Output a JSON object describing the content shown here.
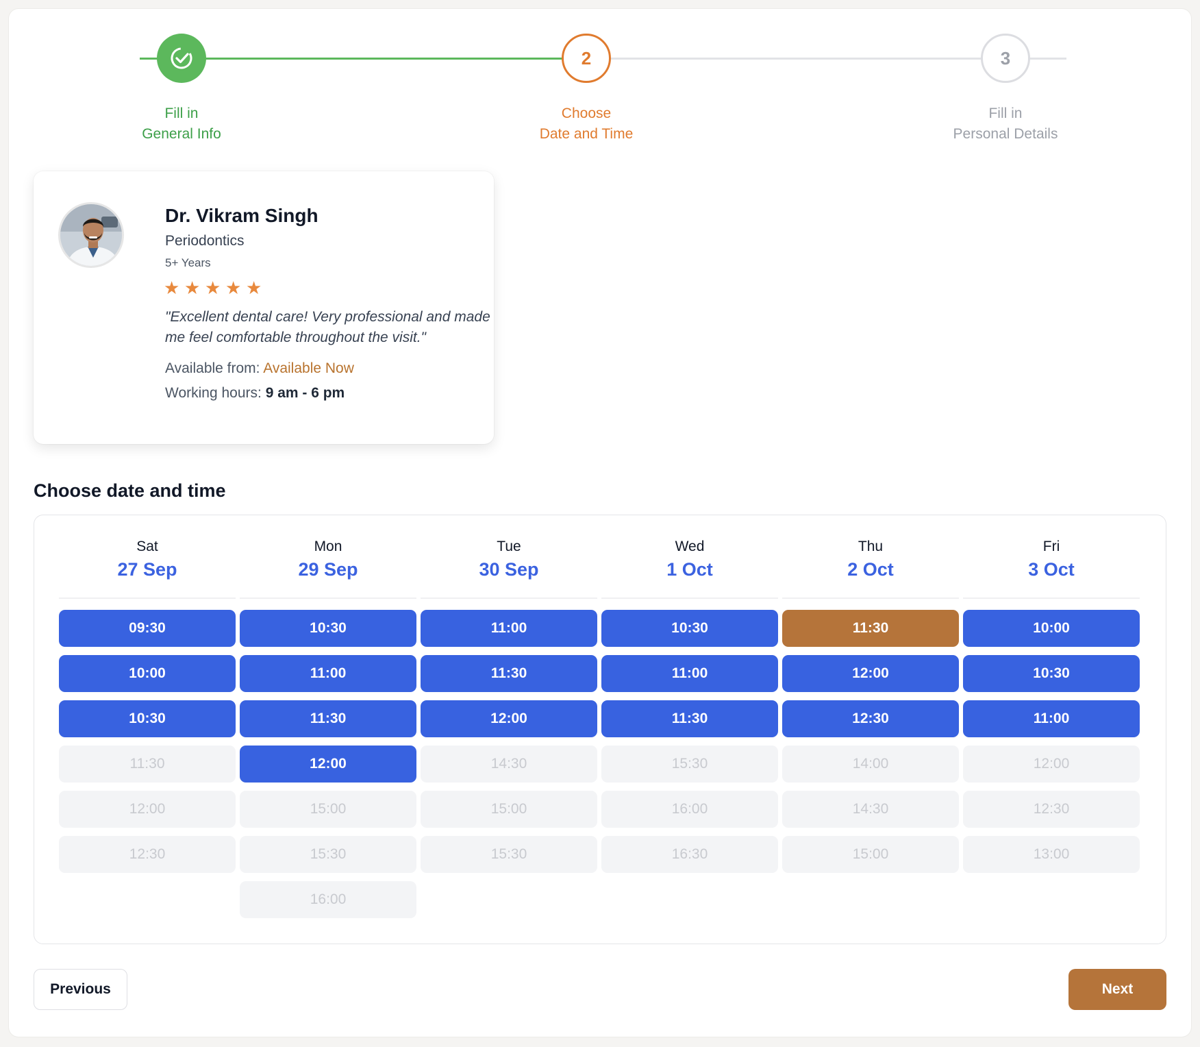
{
  "stepper": {
    "steps": [
      {
        "number": "",
        "line1": "Fill in",
        "line2": "General Info",
        "status": "complete",
        "icon": "check-circle-icon"
      },
      {
        "number": "2",
        "line1": "Choose",
        "line2": "Date and Time",
        "status": "current"
      },
      {
        "number": "3",
        "line1": "Fill in",
        "line2": "Personal Details",
        "status": "upcoming"
      }
    ]
  },
  "doctor": {
    "name": "Dr. Vikram Singh",
    "specialty": "Periodontics",
    "experience": "5+ Years",
    "rating": 5,
    "review": "\"Excellent dental care! Very professional and made me feel comfortable throughout the visit.\"",
    "available_label": "Available from:",
    "available_value": "Available Now",
    "hours_label": "Working hours:",
    "hours_value": "9 am - 6 pm"
  },
  "section_title": "Choose date and time",
  "calendar": {
    "days": [
      {
        "name": "Sat",
        "date": "27 Sep",
        "slots": [
          {
            "time": "09:30",
            "state": "available"
          },
          {
            "time": "10:00",
            "state": "available"
          },
          {
            "time": "10:30",
            "state": "available"
          },
          {
            "time": "11:30",
            "state": "disabled"
          },
          {
            "time": "12:00",
            "state": "disabled"
          },
          {
            "time": "12:30",
            "state": "disabled"
          }
        ]
      },
      {
        "name": "Mon",
        "date": "29 Sep",
        "slots": [
          {
            "time": "10:30",
            "state": "available"
          },
          {
            "time": "11:00",
            "state": "available"
          },
          {
            "time": "11:30",
            "state": "available"
          },
          {
            "time": "12:00",
            "state": "available"
          },
          {
            "time": "15:00",
            "state": "disabled"
          },
          {
            "time": "15:30",
            "state": "disabled"
          },
          {
            "time": "16:00",
            "state": "disabled"
          }
        ]
      },
      {
        "name": "Tue",
        "date": "30 Sep",
        "slots": [
          {
            "time": "11:00",
            "state": "available"
          },
          {
            "time": "11:30",
            "state": "available"
          },
          {
            "time": "12:00",
            "state": "available"
          },
          {
            "time": "14:30",
            "state": "disabled"
          },
          {
            "time": "15:00",
            "state": "disabled"
          },
          {
            "time": "15:30",
            "state": "disabled"
          }
        ]
      },
      {
        "name": "Wed",
        "date": "1 Oct",
        "slots": [
          {
            "time": "10:30",
            "state": "available"
          },
          {
            "time": "11:00",
            "state": "available"
          },
          {
            "time": "11:30",
            "state": "available"
          },
          {
            "time": "15:30",
            "state": "disabled"
          },
          {
            "time": "16:00",
            "state": "disabled"
          },
          {
            "time": "16:30",
            "state": "disabled"
          }
        ]
      },
      {
        "name": "Thu",
        "date": "2 Oct",
        "slots": [
          {
            "time": "11:30",
            "state": "selected"
          },
          {
            "time": "12:00",
            "state": "available"
          },
          {
            "time": "12:30",
            "state": "available"
          },
          {
            "time": "14:00",
            "state": "disabled"
          },
          {
            "time": "14:30",
            "state": "disabled"
          },
          {
            "time": "15:00",
            "state": "disabled"
          }
        ]
      },
      {
        "name": "Fri",
        "date": "3 Oct",
        "slots": [
          {
            "time": "10:00",
            "state": "available"
          },
          {
            "time": "10:30",
            "state": "available"
          },
          {
            "time": "11:00",
            "state": "available"
          },
          {
            "time": "12:00",
            "state": "disabled"
          },
          {
            "time": "12:30",
            "state": "disabled"
          },
          {
            "time": "13:00",
            "state": "disabled"
          }
        ]
      }
    ]
  },
  "footer": {
    "previous_label": "Previous",
    "next_label": "Next"
  },
  "colors": {
    "complete": "#5cb85c",
    "current": "#e07b2e",
    "slot_available": "#3862e0",
    "slot_selected": "#b5743a",
    "slot_disabled": "#f3f4f6",
    "accent": "#b5743a"
  }
}
